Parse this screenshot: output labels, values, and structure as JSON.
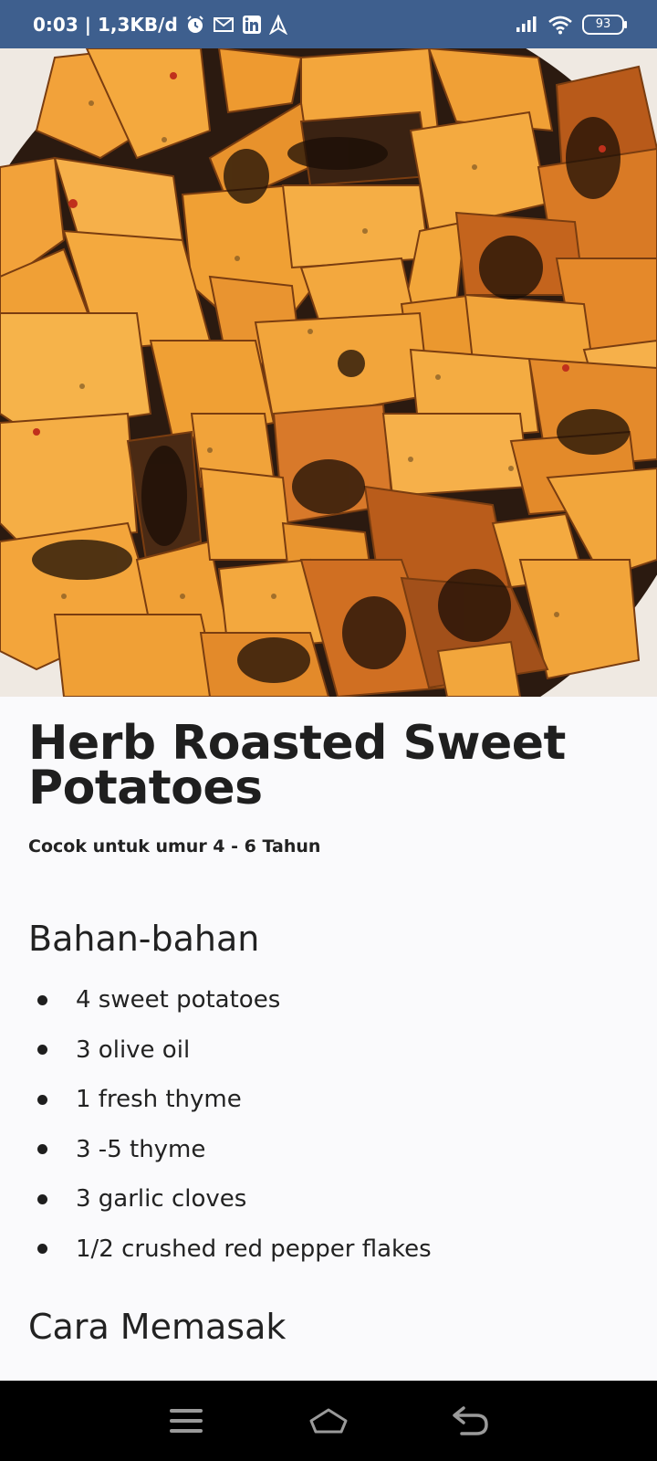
{
  "status_bar": {
    "time_speed": "0:03 | 1,3KB/d",
    "battery": "93",
    "icons": [
      "alarm-icon",
      "gmail-icon",
      "linkedin-icon",
      "arrow-icon",
      "signal-icon",
      "wifi-icon",
      "battery-icon"
    ]
  },
  "recipe": {
    "title": "Herb Roasted Sweet Potatoes",
    "age": "Cocok untuk umur 4 - 6 Tahun",
    "ingredients_heading": "Bahan-bahan",
    "ingredients": [
      "4 sweet potatoes",
      "3 olive oil",
      "1 fresh thyme",
      "3 -5 thyme",
      "3 garlic cloves",
      "1/2 crushed red pepper flakes"
    ],
    "method_heading": "Cara Memasak"
  },
  "nav_bar": {
    "icons": [
      "menu-icon",
      "home-icon",
      "back-icon"
    ]
  },
  "colors": {
    "status_bar": "#3e5f8e",
    "page_background": "#fafafc",
    "nav_bar": "#000000",
    "potato_orange": "#f0a030"
  }
}
